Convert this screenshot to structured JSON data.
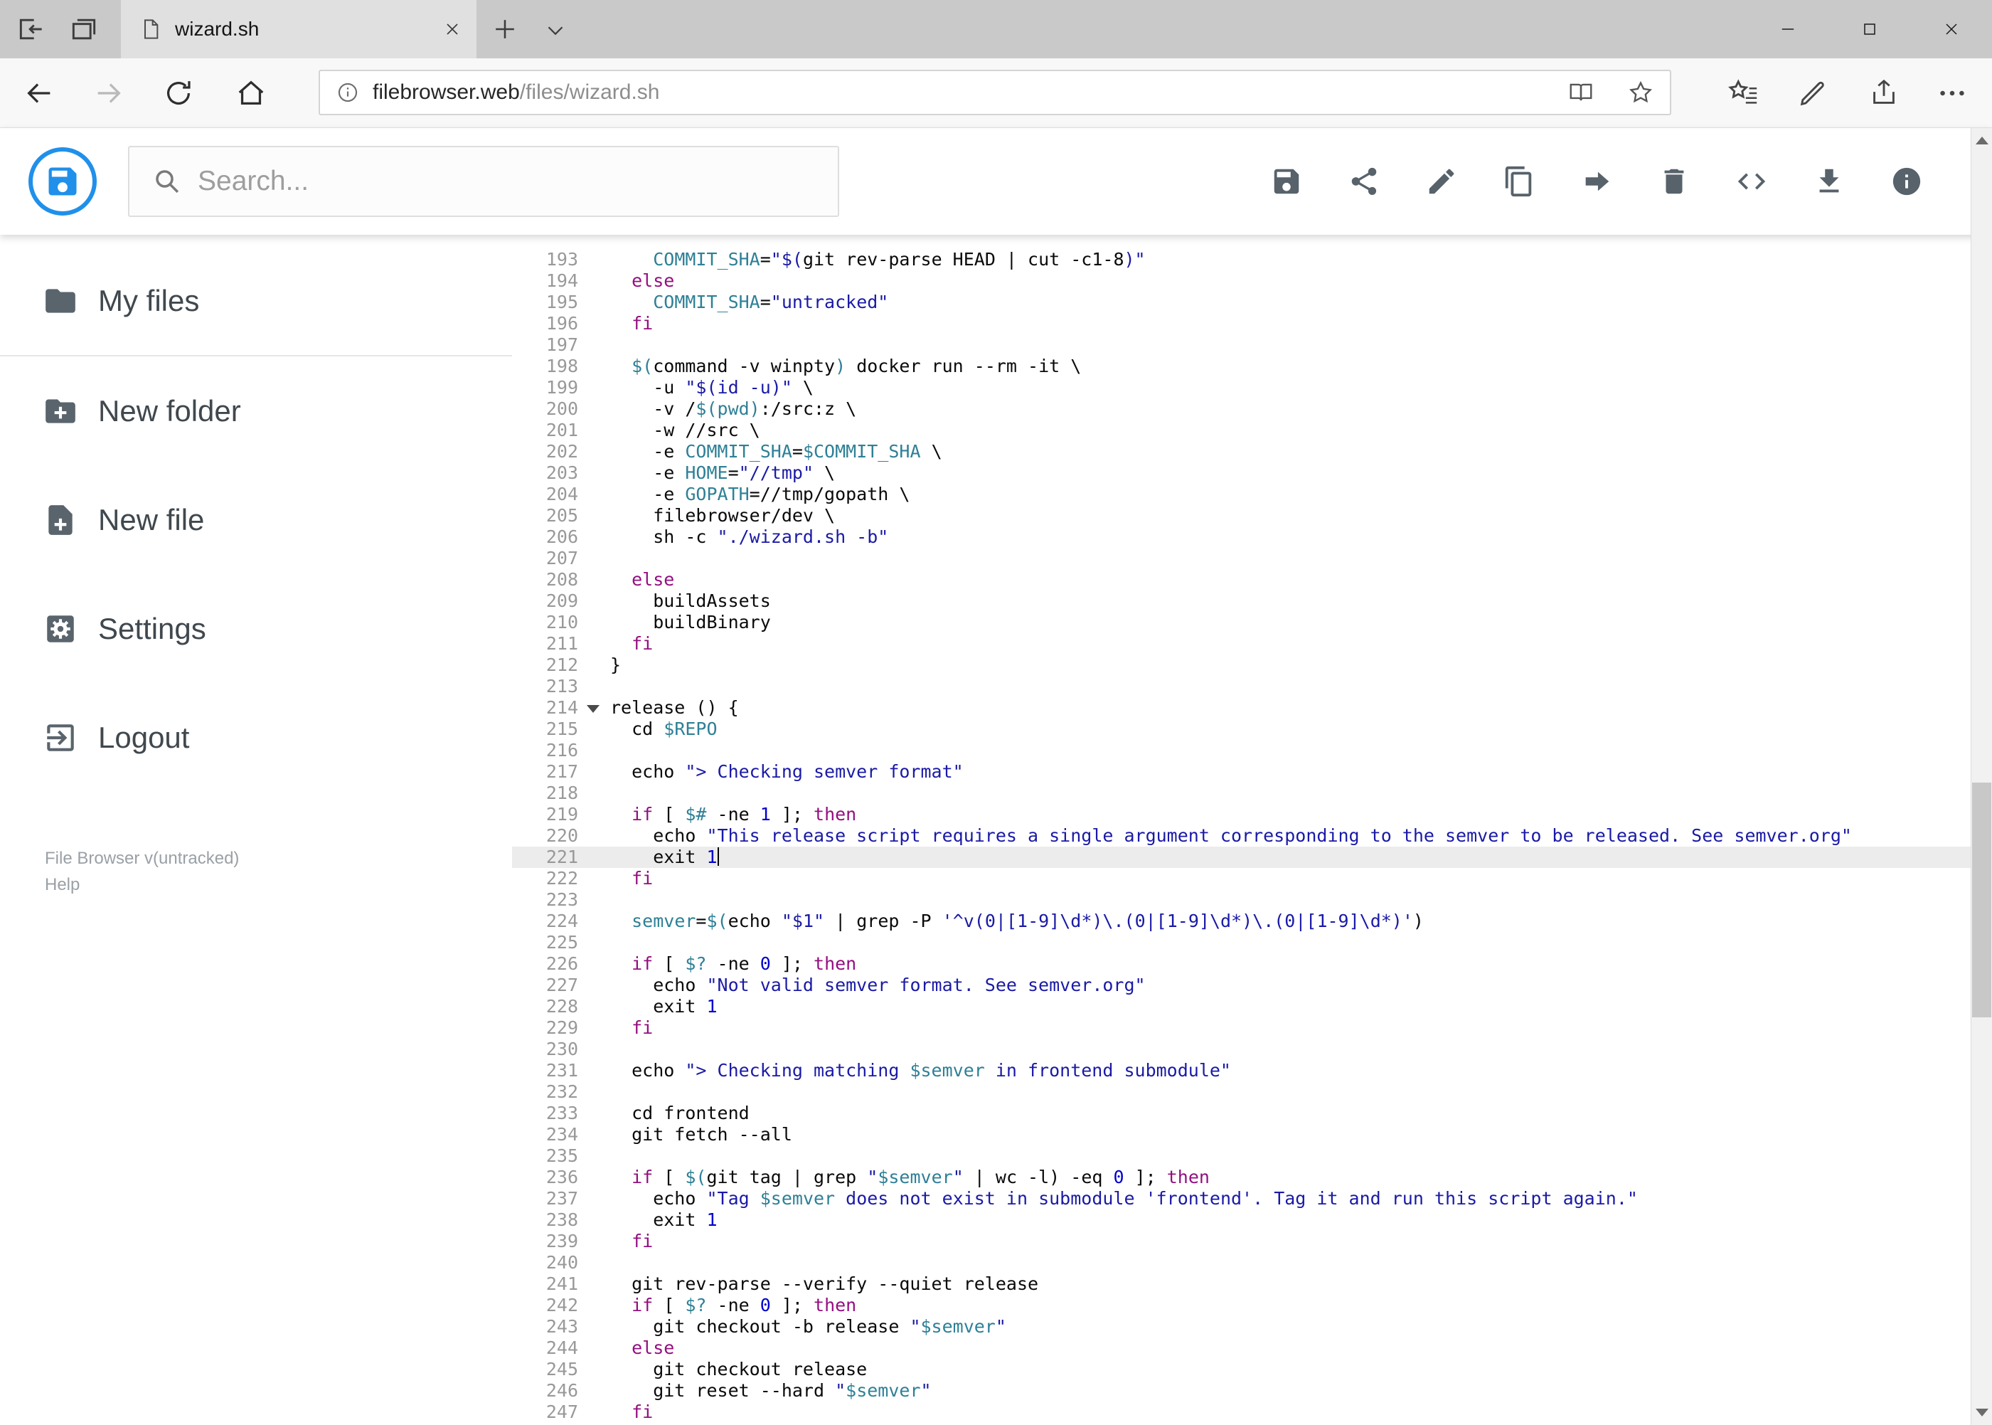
{
  "browser": {
    "tab_title": "wizard.sh",
    "url_host": "filebrowser.web",
    "url_path": "/files/wizard.sh",
    "window_controls": [
      "minimize",
      "maximize",
      "close"
    ],
    "nav_icons": [
      "back",
      "forward",
      "refresh",
      "home",
      "page-info",
      "reading-view",
      "favorite-star",
      "hub",
      "web-note-pen",
      "share",
      "more"
    ]
  },
  "app": {
    "search_placeholder": "Search...",
    "accent_color": "#2090ea",
    "toolbar_actions": [
      "save",
      "share",
      "edit",
      "copy",
      "move",
      "delete",
      "code",
      "download",
      "info"
    ]
  },
  "sidebar": {
    "items": [
      {
        "icon": "folder",
        "label": "My files",
        "divider_after": true
      },
      {
        "icon": "create-folder",
        "label": "New folder"
      },
      {
        "icon": "create-file",
        "label": "New file"
      },
      {
        "icon": "settings",
        "label": "Settings"
      },
      {
        "icon": "logout",
        "label": "Logout"
      }
    ],
    "footer_version": "File Browser v(untracked)",
    "footer_help": "Help"
  },
  "editor": {
    "first_line": 193,
    "last_line": 247,
    "active_line": 221,
    "fold_line": 214,
    "lines": [
      {
        "n": 193,
        "t": [
          [
            "p",
            "    "
          ],
          [
            "v",
            "COMMIT_SHA"
          ],
          [
            "p",
            "="
          ],
          [
            "s",
            "\"$("
          ],
          [
            "p",
            "git rev-parse HEAD | cut -c1-8"
          ],
          [
            "s",
            ")\""
          ]
        ]
      },
      {
        "n": 194,
        "t": [
          [
            "p",
            "  "
          ],
          [
            "k",
            "else"
          ]
        ]
      },
      {
        "n": 195,
        "t": [
          [
            "p",
            "    "
          ],
          [
            "v",
            "COMMIT_SHA"
          ],
          [
            "p",
            "="
          ],
          [
            "s",
            "\"untracked\""
          ]
        ]
      },
      {
        "n": 196,
        "t": [
          [
            "p",
            "  "
          ],
          [
            "k",
            "fi"
          ]
        ]
      },
      {
        "n": 197,
        "t": []
      },
      {
        "n": 198,
        "t": [
          [
            "p",
            "  "
          ],
          [
            "v",
            "$("
          ],
          [
            "p",
            "command -v winpty"
          ],
          [
            "v",
            ")"
          ],
          [
            "p",
            " docker run --rm -it \\"
          ]
        ]
      },
      {
        "n": 199,
        "t": [
          [
            "p",
            "    -u "
          ],
          [
            "s",
            "\"$(id -u)\""
          ],
          [
            "p",
            " \\"
          ]
        ]
      },
      {
        "n": 200,
        "t": [
          [
            "p",
            "    -v /"
          ],
          [
            "v",
            "$(pwd)"
          ],
          [
            "p",
            ":/src:z \\"
          ]
        ]
      },
      {
        "n": 201,
        "t": [
          [
            "p",
            "    -w //src \\"
          ]
        ]
      },
      {
        "n": 202,
        "t": [
          [
            "p",
            "    -e "
          ],
          [
            "v",
            "COMMIT_SHA"
          ],
          [
            "p",
            "="
          ],
          [
            "v",
            "$COMMIT_SHA"
          ],
          [
            "p",
            " \\"
          ]
        ]
      },
      {
        "n": 203,
        "t": [
          [
            "p",
            "    -e "
          ],
          [
            "v",
            "HOME"
          ],
          [
            "p",
            "="
          ],
          [
            "s",
            "\"//tmp\""
          ],
          [
            "p",
            " \\"
          ]
        ]
      },
      {
        "n": 204,
        "t": [
          [
            "p",
            "    -e "
          ],
          [
            "v",
            "GOPATH"
          ],
          [
            "p",
            "=//tmp/gopath \\"
          ]
        ]
      },
      {
        "n": 205,
        "t": [
          [
            "p",
            "    filebrowser/dev \\"
          ]
        ]
      },
      {
        "n": 206,
        "t": [
          [
            "p",
            "    sh -c "
          ],
          [
            "s",
            "\"./wizard.sh -b\""
          ]
        ]
      },
      {
        "n": 207,
        "t": []
      },
      {
        "n": 208,
        "t": [
          [
            "p",
            "  "
          ],
          [
            "k",
            "else"
          ]
        ]
      },
      {
        "n": 209,
        "t": [
          [
            "p",
            "    buildAssets"
          ]
        ]
      },
      {
        "n": 210,
        "t": [
          [
            "p",
            "    buildBinary"
          ]
        ]
      },
      {
        "n": 211,
        "t": [
          [
            "p",
            "  "
          ],
          [
            "k",
            "fi"
          ]
        ]
      },
      {
        "n": 212,
        "t": [
          [
            "p",
            "}"
          ]
        ]
      },
      {
        "n": 213,
        "t": []
      },
      {
        "n": 214,
        "t": [
          [
            "p",
            "release () {"
          ]
        ],
        "fold": true
      },
      {
        "n": 215,
        "t": [
          [
            "p",
            "  cd "
          ],
          [
            "v",
            "$REPO"
          ]
        ]
      },
      {
        "n": 216,
        "t": []
      },
      {
        "n": 217,
        "t": [
          [
            "p",
            "  echo "
          ],
          [
            "s",
            "\"> Checking semver format\""
          ]
        ]
      },
      {
        "n": 218,
        "t": []
      },
      {
        "n": 219,
        "t": [
          [
            "p",
            "  "
          ],
          [
            "k",
            "if"
          ],
          [
            "p",
            " [ "
          ],
          [
            "v",
            "$#"
          ],
          [
            "p",
            " -ne "
          ],
          [
            "num",
            "1"
          ],
          [
            "p",
            " ]; "
          ],
          [
            "k",
            "then"
          ]
        ]
      },
      {
        "n": 220,
        "t": [
          [
            "p",
            "    echo "
          ],
          [
            "s",
            "\"This release script requires a single argument corresponding to the semver to be released. See semver.org\""
          ]
        ]
      },
      {
        "n": 221,
        "t": [
          [
            "p",
            "    exit "
          ],
          [
            "num",
            "1"
          ]
        ],
        "cursor": true
      },
      {
        "n": 222,
        "t": [
          [
            "p",
            "  "
          ],
          [
            "k",
            "fi"
          ]
        ]
      },
      {
        "n": 223,
        "t": []
      },
      {
        "n": 224,
        "t": [
          [
            "p",
            "  "
          ],
          [
            "v",
            "semver"
          ],
          [
            "p",
            "="
          ],
          [
            "v",
            "$("
          ],
          [
            "p",
            "echo "
          ],
          [
            "s",
            "\"$1\""
          ],
          [
            "p",
            " | grep -P "
          ],
          [
            "s",
            "'^v(0|[1-9]\\d*)\\.(0|[1-9]\\d*)\\.(0|[1-9]\\d*)'"
          ],
          [
            "p",
            ")"
          ]
        ]
      },
      {
        "n": 225,
        "t": []
      },
      {
        "n": 226,
        "t": [
          [
            "p",
            "  "
          ],
          [
            "k",
            "if"
          ],
          [
            "p",
            " [ "
          ],
          [
            "v",
            "$?"
          ],
          [
            "p",
            " -ne "
          ],
          [
            "num",
            "0"
          ],
          [
            "p",
            " ]; "
          ],
          [
            "k",
            "then"
          ]
        ]
      },
      {
        "n": 227,
        "t": [
          [
            "p",
            "    echo "
          ],
          [
            "s",
            "\"Not valid semver format. See semver.org\""
          ]
        ]
      },
      {
        "n": 228,
        "t": [
          [
            "p",
            "    exit "
          ],
          [
            "num",
            "1"
          ]
        ]
      },
      {
        "n": 229,
        "t": [
          [
            "p",
            "  "
          ],
          [
            "k",
            "fi"
          ]
        ]
      },
      {
        "n": 230,
        "t": []
      },
      {
        "n": 231,
        "t": [
          [
            "p",
            "  echo "
          ],
          [
            "s",
            "\"> Checking matching "
          ],
          [
            "v",
            "$semver"
          ],
          [
            "s",
            " in frontend submodule\""
          ]
        ]
      },
      {
        "n": 232,
        "t": []
      },
      {
        "n": 233,
        "t": [
          [
            "p",
            "  cd frontend"
          ]
        ]
      },
      {
        "n": 234,
        "t": [
          [
            "p",
            "  git fetch --all"
          ]
        ]
      },
      {
        "n": 235,
        "t": []
      },
      {
        "n": 236,
        "t": [
          [
            "p",
            "  "
          ],
          [
            "k",
            "if"
          ],
          [
            "p",
            " [ "
          ],
          [
            "v",
            "$("
          ],
          [
            "p",
            "git tag | grep "
          ],
          [
            "s",
            "\""
          ],
          [
            "v",
            "$semver"
          ],
          [
            "s",
            "\""
          ],
          [
            "p",
            " | wc -l) -eq "
          ],
          [
            "num",
            "0"
          ],
          [
            "p",
            " ]; "
          ],
          [
            "k",
            "then"
          ]
        ]
      },
      {
        "n": 237,
        "t": [
          [
            "p",
            "    echo "
          ],
          [
            "s",
            "\"Tag "
          ],
          [
            "v",
            "$semver"
          ],
          [
            "s",
            " does not exist in submodule 'frontend'. Tag it and run this script again.\""
          ]
        ]
      },
      {
        "n": 238,
        "t": [
          [
            "p",
            "    exit "
          ],
          [
            "num",
            "1"
          ]
        ]
      },
      {
        "n": 239,
        "t": [
          [
            "p",
            "  "
          ],
          [
            "k",
            "fi"
          ]
        ]
      },
      {
        "n": 240,
        "t": []
      },
      {
        "n": 241,
        "t": [
          [
            "p",
            "  git rev-parse --verify --quiet release"
          ]
        ]
      },
      {
        "n": 242,
        "t": [
          [
            "p",
            "  "
          ],
          [
            "k",
            "if"
          ],
          [
            "p",
            " [ "
          ],
          [
            "v",
            "$?"
          ],
          [
            "p",
            " -ne "
          ],
          [
            "num",
            "0"
          ],
          [
            "p",
            " ]; "
          ],
          [
            "k",
            "then"
          ]
        ]
      },
      {
        "n": 243,
        "t": [
          [
            "p",
            "    git checkout -b release "
          ],
          [
            "s",
            "\""
          ],
          [
            "v",
            "$semver"
          ],
          [
            "s",
            "\""
          ]
        ]
      },
      {
        "n": 244,
        "t": [
          [
            "p",
            "  "
          ],
          [
            "k",
            "else"
          ]
        ]
      },
      {
        "n": 245,
        "t": [
          [
            "p",
            "    git checkout release"
          ]
        ]
      },
      {
        "n": 246,
        "t": [
          [
            "p",
            "    git reset --hard "
          ],
          [
            "s",
            "\""
          ],
          [
            "v",
            "$semver"
          ],
          [
            "s",
            "\""
          ]
        ]
      },
      {
        "n": 247,
        "t": [
          [
            "p",
            "  "
          ],
          [
            "k",
            "fi"
          ]
        ]
      }
    ]
  }
}
